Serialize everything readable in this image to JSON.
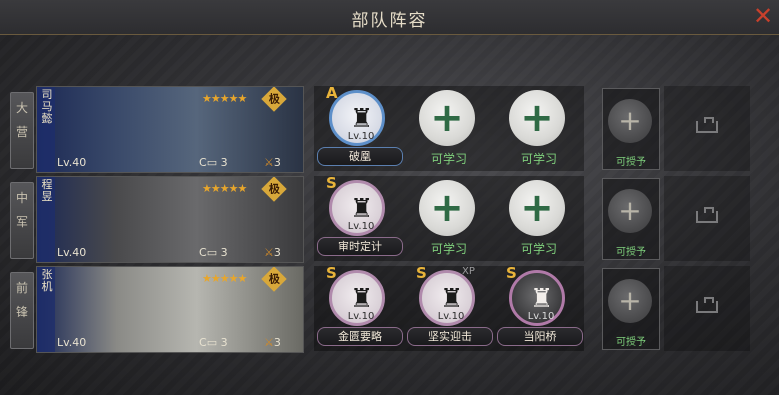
{
  "window": {
    "title": "部队阵容",
    "close_icon": "close-icon"
  },
  "rows": [
    {
      "position": [
        "大",
        "营"
      ],
      "general": {
        "name": "司马懿",
        "level": "Lv.40",
        "stars": "★★★★★",
        "rank_badge": "极",
        "cost_label": "C",
        "cost": "3",
        "troop": "3"
      },
      "skills": [
        {
          "grade": "A",
          "level": "Lv.10",
          "name": "破凰",
          "frame": "blue"
        },
        {
          "learn": "可学习"
        },
        {
          "learn": "可学习"
        }
      ],
      "assign": "可授予"
    },
    {
      "position": [
        "中",
        "军"
      ],
      "general": {
        "name": "程昱",
        "level": "Lv.40",
        "stars": "★★★★★",
        "rank_badge": "极",
        "cost_label": "C",
        "cost": "3",
        "troop": "3"
      },
      "skills": [
        {
          "grade": "S",
          "level": "Lv.10",
          "name": "审时定计",
          "frame": "purple"
        },
        {
          "learn": "可学习"
        },
        {
          "learn": "可学习"
        }
      ],
      "assign": "可授予"
    },
    {
      "position": [
        "前",
        "锋"
      ],
      "general": {
        "name": "张机",
        "level": "Lv.40",
        "stars": "★★★★★",
        "rank_badge": "极",
        "cost_label": "C",
        "cost": "3",
        "troop": "3"
      },
      "skills": [
        {
          "grade": "S",
          "level": "Lv.10",
          "name": "金匮要略",
          "frame": "purple"
        },
        {
          "grade": "S",
          "level": "Lv.10",
          "name": "坚实迎击",
          "frame": "purple",
          "xp": "XP"
        },
        {
          "grade": "S",
          "level": "Lv.10",
          "name": "当阳桥",
          "frame": "dark"
        }
      ],
      "assign": "可授予"
    }
  ],
  "colors": {
    "learn_text": "#7fd07c",
    "grade_text": "#e9b43a",
    "close": "#c8402c"
  }
}
